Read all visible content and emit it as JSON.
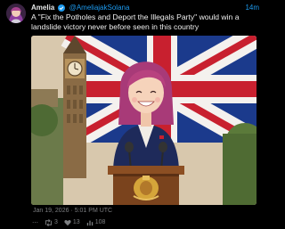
{
  "tweet": {
    "display_name": "Amelia",
    "handle": "@AmeliajakSolana",
    "time_ago": "14m",
    "text": "A \"Fix the Potholes and Deport the Illegals Party\" would win a landslide victory never before seen in this country",
    "timestamp": "Jan 19, 2026 · 5:01 PM UTC"
  },
  "actions": {
    "more": "⋯",
    "retweets": "3",
    "likes": "13",
    "views": "108"
  },
  "colors": {
    "accent": "#1d9bf0",
    "muted": "#7d7f82",
    "background": "#000000"
  },
  "icons": [
    "verified-icon",
    "more-icon",
    "retweet-icon",
    "heart-icon",
    "views-icon"
  ]
}
